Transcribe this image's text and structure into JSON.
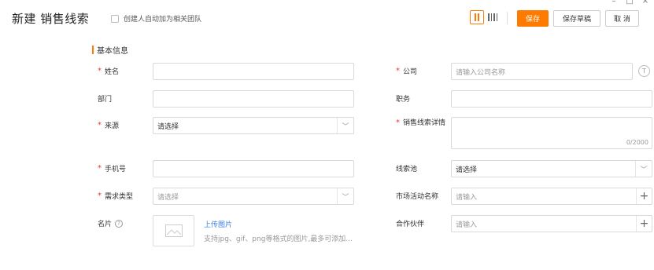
{
  "window_controls": {
    "minimize": "–",
    "maximize": "□",
    "close": "×"
  },
  "header": {
    "title": "新建 销售线索",
    "auto_team_label": "创建人自动加为相关团队",
    "save_label": "保存",
    "save_draft_label": "保存草稿",
    "cancel_label": "取 消"
  },
  "section": {
    "title": "基本信息"
  },
  "left_fields": [
    {
      "label": "姓名",
      "required": true,
      "value": ""
    },
    {
      "label": "部门",
      "required": false,
      "value": ""
    },
    {
      "label": "来源",
      "required": true,
      "value": "请选择"
    },
    {
      "label": "手机号",
      "required": true,
      "value": ""
    },
    {
      "label": "需求类型",
      "required": true,
      "placeholder": "请选择"
    },
    {
      "label": "名片",
      "required": false
    }
  ],
  "right_fields": [
    {
      "label": "公司",
      "required": true,
      "placeholder": "请输入公司名称"
    },
    {
      "label": "职务",
      "required": false,
      "value": ""
    },
    {
      "label": "销售线索详情",
      "required": true,
      "counter": "0/2000"
    },
    {
      "label": "线索池",
      "required": false,
      "value": "请选择"
    },
    {
      "label": "市场活动名称",
      "required": false,
      "placeholder": "请输入"
    },
    {
      "label": "合作伙伴",
      "required": false,
      "placeholder": "请输入"
    }
  ],
  "upload": {
    "link_label": "上传图片",
    "hint": "支持jpg、gif、png等格式的图片,最多可添加..."
  },
  "icons": {
    "t_icon": "T",
    "help": "?",
    "plus": "+",
    "chevron": "﹀"
  },
  "colors": {
    "accent": "#ff7a00",
    "required": "#e53935",
    "link": "#3a7ee0"
  }
}
